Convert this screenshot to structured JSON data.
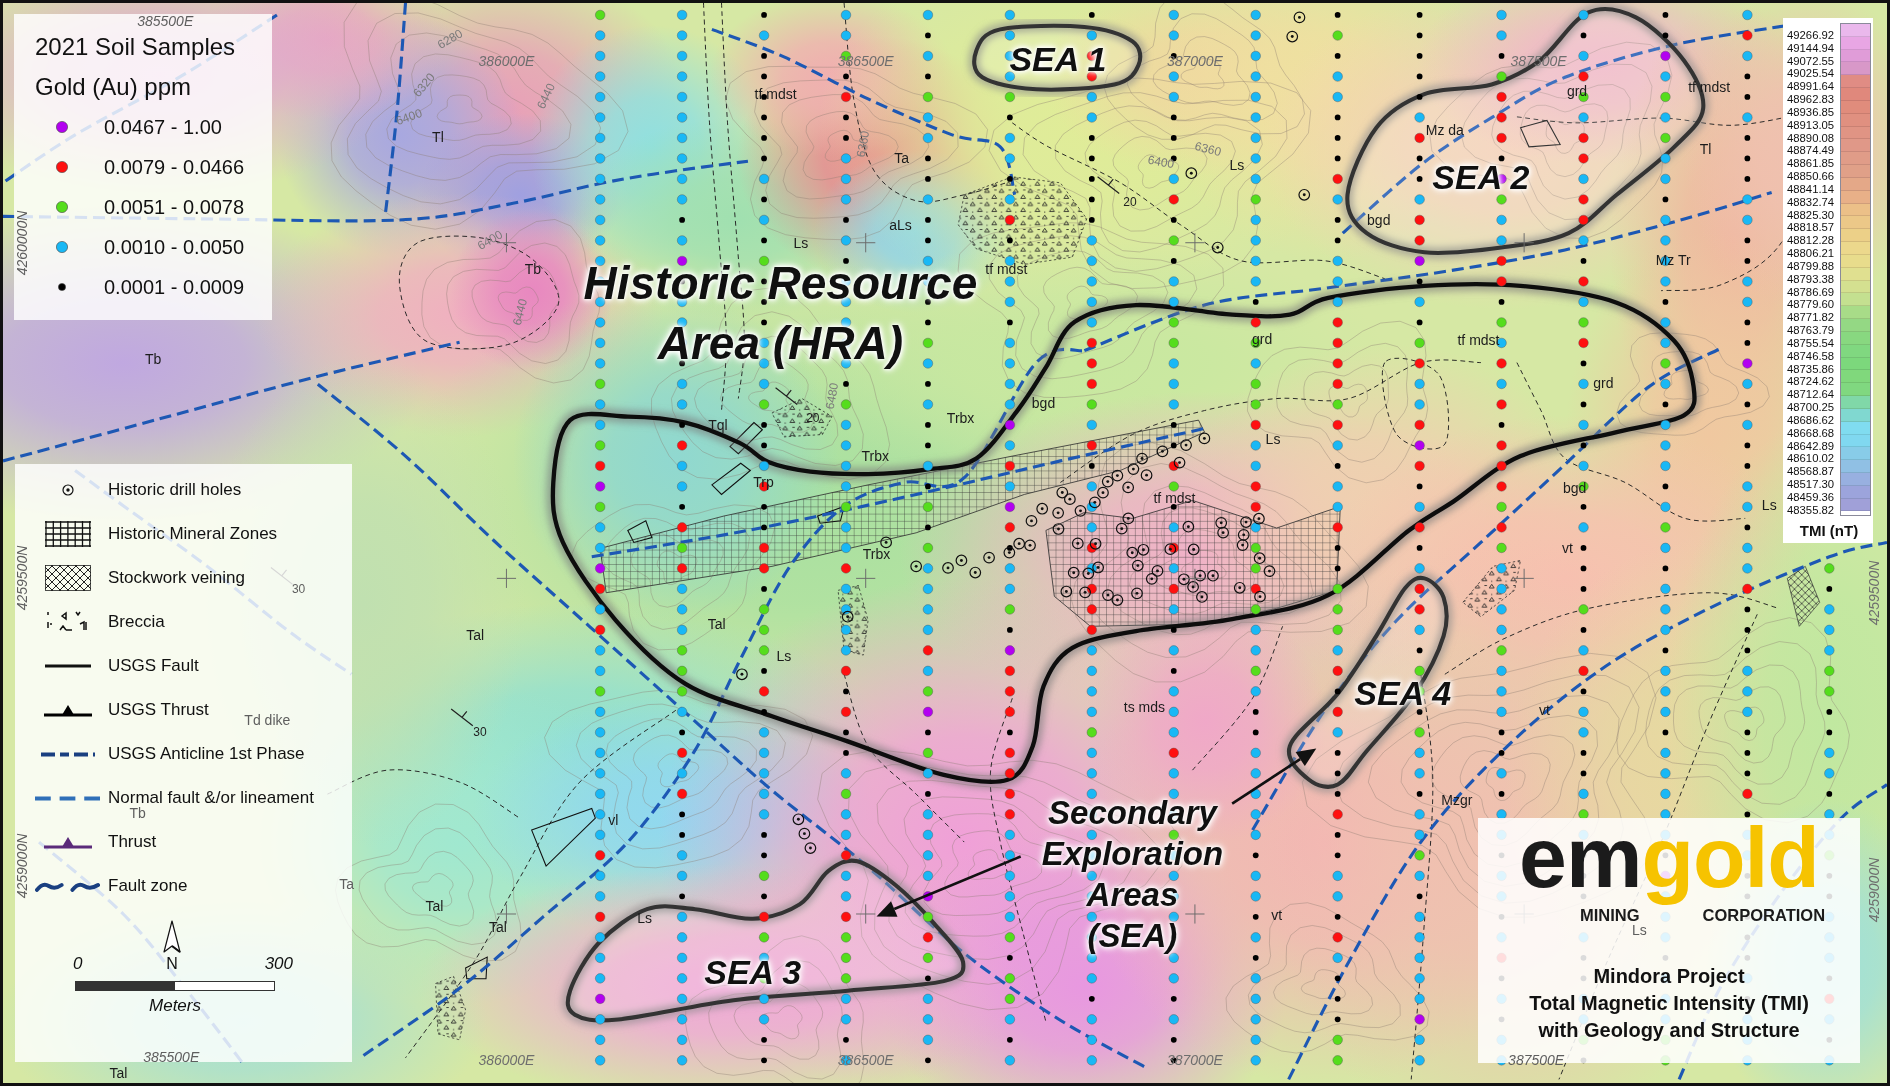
{
  "soil_legend": {
    "title": "2021 Soil Samples",
    "subtitle": "Gold (Au) ppm",
    "items": [
      {
        "label": "0.0467 - 1.00",
        "color": "#b300f0"
      },
      {
        "label": "0.0079 - 0.0466",
        "color": "#ff1010"
      },
      {
        "label": "0.0051 - 0.0078",
        "color": "#55dd1c"
      },
      {
        "label": "0.0010 - 0.0050",
        "color": "#19b8f5"
      },
      {
        "label": "0.0001 - 0.0009",
        "color": "#000000"
      }
    ]
  },
  "map_legend": {
    "items": [
      {
        "kind": "drill_hole",
        "label": "Historic drill holes"
      },
      {
        "kind": "grid_hatch",
        "label": "Historic Mineral Zones"
      },
      {
        "kind": "cross_hatch",
        "label": "Stockwork veining"
      },
      {
        "kind": "breccia",
        "label": "Breccia"
      },
      {
        "kind": "fault",
        "label": "USGS Fault"
      },
      {
        "kind": "thrust",
        "label": "USGS Thrust",
        "color": "#000000"
      },
      {
        "kind": "anticline",
        "label": "USGS Anticline 1st Phase"
      },
      {
        "kind": "normal_fault",
        "label": "Normal fault &/or lineament"
      },
      {
        "kind": "thrust",
        "label": "Thrust",
        "color": "#5b2a7a"
      },
      {
        "kind": "fault_zone",
        "label": "Fault zone"
      }
    ],
    "north": "N",
    "scale": {
      "start": "0",
      "end": "300",
      "unit": "Meters"
    }
  },
  "tmi_scale": {
    "title": "TMI (nT)",
    "items": [
      {
        "label": "49266.92",
        "color": "#eab8ec"
      },
      {
        "label": "49144.94",
        "color": "#e8a6e4"
      },
      {
        "label": "49072.55",
        "color": "#e09cd8"
      },
      {
        "label": "49025.54",
        "color": "#d898c8"
      },
      {
        "label": "48991.64",
        "color": "#e08c84"
      },
      {
        "label": "48962.83",
        "color": "#e0887c"
      },
      {
        "label": "48936.85",
        "color": "#e08c7c"
      },
      {
        "label": "48913.05",
        "color": "#e09080"
      },
      {
        "label": "48890.08",
        "color": "#e09484"
      },
      {
        "label": "48874.49",
        "color": "#e09888"
      },
      {
        "label": "48861.85",
        "color": "#e09c88"
      },
      {
        "label": "48850.66",
        "color": "#e0a088"
      },
      {
        "label": "48841.14",
        "color": "#e4a888"
      },
      {
        "label": "48832.74",
        "color": "#e8b088"
      },
      {
        "label": "48825.30",
        "color": "#ecc088"
      },
      {
        "label": "48818.57",
        "color": "#ecc888"
      },
      {
        "label": "48812.28",
        "color": "#ecd088"
      },
      {
        "label": "48806.21",
        "color": "#ecd88c"
      },
      {
        "label": "48799.88",
        "color": "#e8dc8c"
      },
      {
        "label": "48793.38",
        "color": "#e0e090"
      },
      {
        "label": "48786.69",
        "color": "#d4e090"
      },
      {
        "label": "48779.60",
        "color": "#c4e090"
      },
      {
        "label": "48771.82",
        "color": "#a8dc88"
      },
      {
        "label": "48763.79",
        "color": "#94d884"
      },
      {
        "label": "48755.54",
        "color": "#88d880"
      },
      {
        "label": "48746.58",
        "color": "#80d880"
      },
      {
        "label": "48735.86",
        "color": "#7cd87c"
      },
      {
        "label": "48724.62",
        "color": "#80d87c"
      },
      {
        "label": "48712.64",
        "color": "#80d880"
      },
      {
        "label": "48700.25",
        "color": "#80d8a8"
      },
      {
        "label": "48686.62",
        "color": "#80d8d0"
      },
      {
        "label": "48668.68",
        "color": "#80dcf0"
      },
      {
        "label": "48642.89",
        "color": "#80d8f0"
      },
      {
        "label": "48610.02",
        "color": "#88cce8"
      },
      {
        "label": "48568.87",
        "color": "#90c0e4"
      },
      {
        "label": "48517.30",
        "color": "#98b0e0"
      },
      {
        "label": "48459.36",
        "color": "#9ca4dc"
      },
      {
        "label": "48355.82",
        "color": "#a0a0d8"
      }
    ]
  },
  "logo": {
    "wordmark": [
      "em",
      "gold"
    ],
    "tagline": [
      "MINING",
      "CORPORATION"
    ]
  },
  "title_block": [
    "Mindora Project",
    "Total Magnetic Intensity (TMI)",
    "with Geology and Structure"
  ],
  "map": {
    "area_labels": [
      {
        "lines": [
          "SEA 1"
        ]
      },
      {
        "lines": [
          "SEA 2"
        ]
      },
      {
        "lines": [
          "Historic Resource",
          "Area (HRA)"
        ]
      },
      {
        "lines": [
          "SEA 4"
        ]
      },
      {
        "lines": [
          "Secondary",
          "Exploration",
          "Areas",
          "(SEA)"
        ]
      },
      {
        "lines": [
          "SEA 3"
        ]
      }
    ],
    "unit_labels": [
      "tf mdst",
      "grd",
      "tf mdst",
      "Tl",
      "Ta",
      "Ls",
      "Mz da",
      "Tl",
      "Tb",
      "Ls",
      "aLs",
      "tf mdst",
      "bgd",
      "Mz Tr",
      "grd",
      "tf mdst",
      "Tb",
      "Tql",
      "Trbx",
      "Trbx",
      "bgd",
      "Ls",
      "grd",
      "Trp",
      "tf mdst",
      "bgd",
      "Ls",
      "Trbx",
      "vt",
      "Tal",
      "Tal",
      "Ls",
      "Td dike",
      "ts mds",
      "vt",
      "Tb",
      "vl",
      "Mzgr",
      "Ta",
      "Tal",
      "Tal",
      "Ls",
      "vt",
      "Ls",
      "Tal"
    ],
    "grid_labels": [
      "385500E",
      "386000E",
      "386500E",
      "387000E",
      "387500E",
      "4260000N",
      "4259500N",
      "4259500N",
      "4259000N",
      "4259000N",
      "385500E",
      "386000E",
      "386500E",
      "387000E",
      "387500E"
    ],
    "contour_labels": [
      "6280",
      "6400",
      "6320",
      "6440",
      "6360",
      "6400",
      "6360",
      "6400",
      "6440",
      "6480"
    ],
    "dip_labels": [
      "20",
      "20",
      "30",
      "30"
    ]
  }
}
